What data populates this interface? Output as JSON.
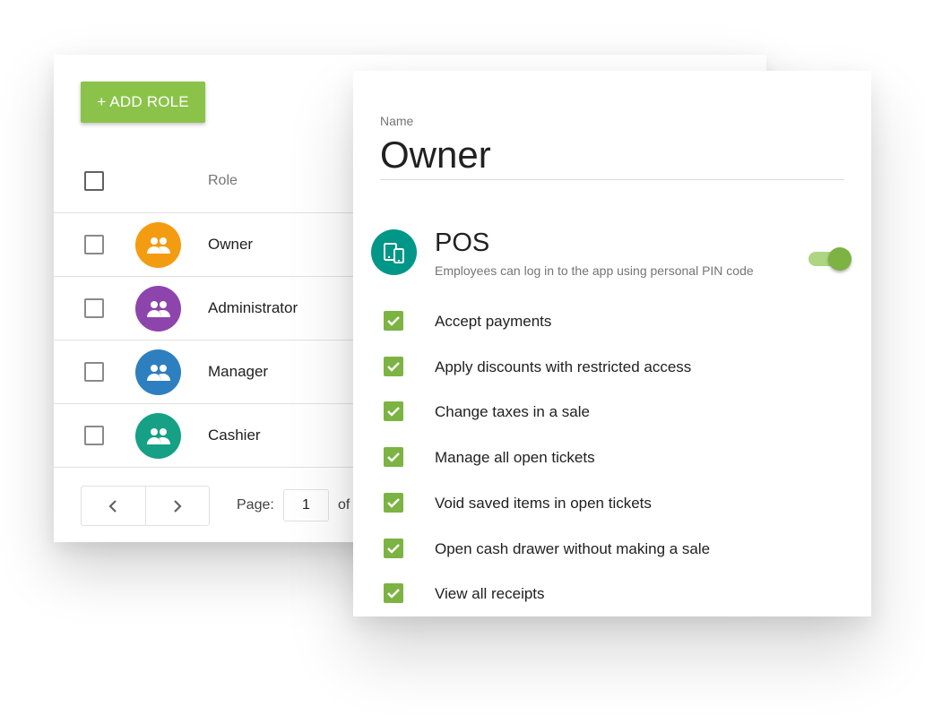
{
  "roles_list": {
    "add_role_label": "+ ADD ROLE",
    "header": {
      "role_column": "Role"
    },
    "rows": [
      {
        "name": "Owner",
        "avatar_color": "#f39c12",
        "icon": "people-icon"
      },
      {
        "name": "Administrator",
        "avatar_color": "#8e44ad",
        "icon": "people-icon"
      },
      {
        "name": "Manager",
        "avatar_color": "#2e7fbf",
        "icon": "people-icon"
      },
      {
        "name": "Cashier",
        "avatar_color": "#16a085",
        "icon": "people-icon"
      }
    ],
    "pagination": {
      "prev_icon": "chevron-left-icon",
      "next_icon": "chevron-right-icon",
      "page_label": "Page:",
      "page_value": "1",
      "of_label": "of"
    }
  },
  "role_detail": {
    "name_label": "Name",
    "name_value": "Owner",
    "pos": {
      "icon": "devices-icon",
      "icon_color": "#009688",
      "title": "POS",
      "description": "Employees can log in to the app using personal PIN code",
      "enabled": true
    },
    "permissions": [
      {
        "label": "Accept payments",
        "checked": true
      },
      {
        "label": "Apply discounts with restricted access",
        "checked": true
      },
      {
        "label": "Change taxes in a sale",
        "checked": true
      },
      {
        "label": "Manage all open tickets",
        "checked": true
      },
      {
        "label": "Void saved items in open tickets",
        "checked": true
      },
      {
        "label": "Open cash drawer without making a sale",
        "checked": true
      },
      {
        "label": "View all receipts",
        "checked": true
      }
    ]
  },
  "colors": {
    "accent_green": "#8bc34a",
    "checkbox_green": "#7cb342",
    "toggle_track": "#aed581"
  }
}
